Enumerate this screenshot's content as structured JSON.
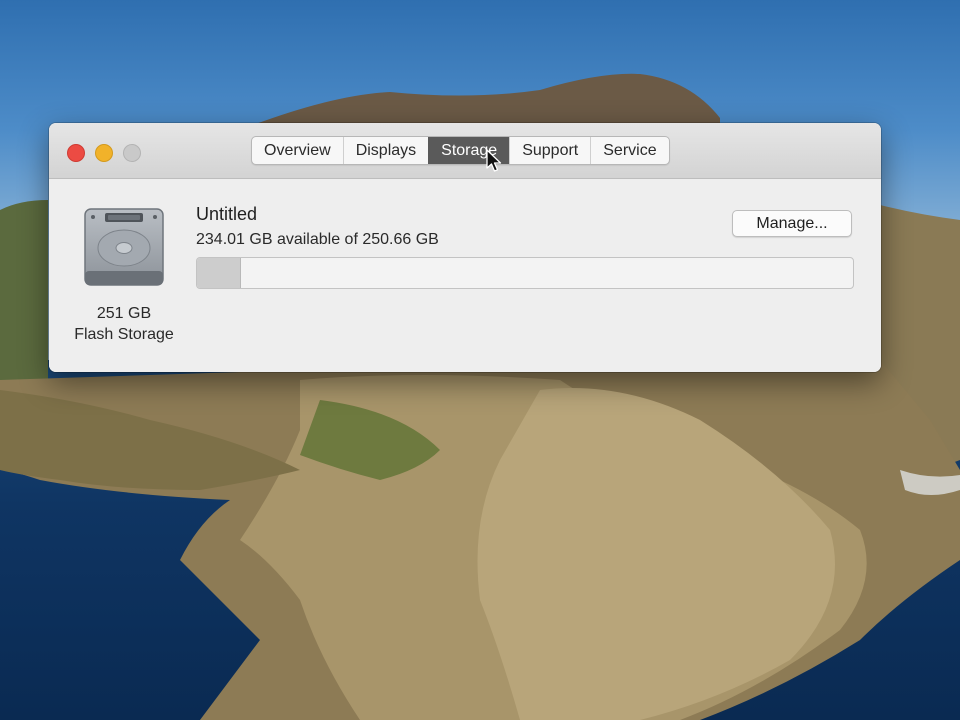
{
  "window": {
    "traffic_lights": {
      "close_color": "#ec4b43",
      "minimize_color": "#f1b22a",
      "zoom_color": "#c9c9c9"
    },
    "tabs": [
      {
        "label": "Overview",
        "active": false
      },
      {
        "label": "Displays",
        "active": false
      },
      {
        "label": "Storage",
        "active": true
      },
      {
        "label": "Support",
        "active": false
      },
      {
        "label": "Service",
        "active": false
      }
    ]
  },
  "storage": {
    "drive": {
      "icon": "hard-drive-icon",
      "size_label": "251 GB",
      "type_label": "Flash Storage"
    },
    "volume": {
      "name": "Untitled",
      "availability": "234.01 GB available of 250.66 GB",
      "used_fraction": 0.066
    },
    "manage_label": "Manage..."
  }
}
